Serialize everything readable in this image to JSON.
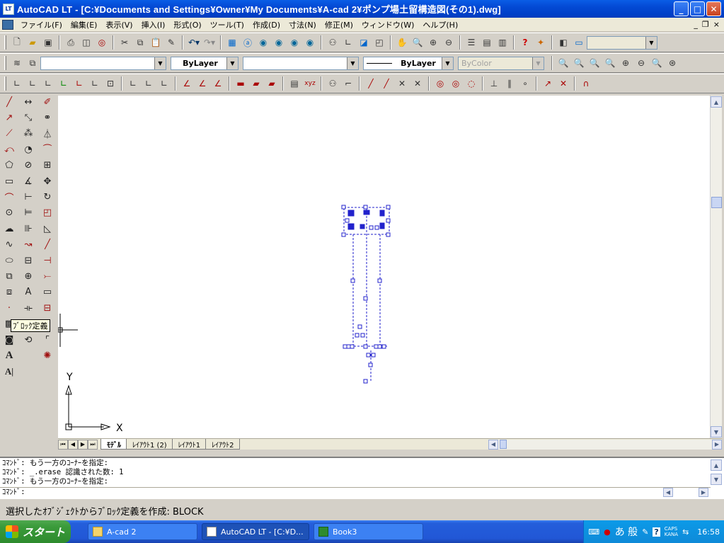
{
  "window": {
    "app_icon": "LT",
    "title": "AutoCAD LT - [C:¥Documents and Settings¥Owner¥My Documents¥A-cad 2¥ポンプ場土留構造図(その1).dwg]",
    "controls": [
      "minimize",
      "maximize",
      "close"
    ]
  },
  "menu": {
    "items": [
      "ファイル(F)",
      "編集(E)",
      "表示(V)",
      "挿入(I)",
      "形式(O)",
      "ツール(T)",
      "作成(D)",
      "寸法(N)",
      "修正(M)",
      "ウィンドウ(W)",
      "ヘルプ(H)"
    ],
    "mdi_controls": [
      "_",
      "❐",
      "×"
    ]
  },
  "toolbars": {
    "layer_dropdown": "",
    "color_dropdown": "ByLayer",
    "linetype_dropdown": "",
    "lineweight_dropdown": "ByLayer",
    "plotstyle_dropdown": "ByColor",
    "named_view_dropdown": ""
  },
  "tooltip": "ﾌﾞﾛｯｸ定義",
  "ucs": {
    "x_label": "X",
    "y_label": "Y"
  },
  "layout_tabs": [
    "ﾓﾃﾞﾙ",
    "ﾚｲｱｳﾄ1 (2)",
    "ﾚｲｱｳﾄ1",
    "ﾚｲｱｳﾄ2"
  ],
  "command_history": [
    "ｺﾏﾝﾄﾞ: もう一方のｺｰﾅｰを指定:",
    "ｺﾏﾝﾄﾞ: _.erase 認識された数: 1",
    "ｺﾏﾝﾄﾞ: もう一方のｺｰﾅｰを指定:"
  ],
  "command_prompt": "ｺﾏﾝﾄﾞ:",
  "status_text": "選択したｵﾌﾞｼﾞｪｸﾄからﾌﾞﾛｯｸ定義を作成:  BLOCK",
  "taskbar": {
    "start_label": "スタート",
    "tasks": [
      {
        "label": "A-cad 2",
        "icon": "folder-icon"
      },
      {
        "label": "AutoCAD LT - [C:¥D...",
        "icon": "autocad-icon"
      },
      {
        "label": "Book3",
        "icon": "excel-icon"
      }
    ],
    "ime_text": "あ 般",
    "caps": "CAPS",
    "kana": "KANA",
    "clock": "16:58"
  },
  "colors": {
    "selection_blue": "#2222cc",
    "titlebar_blue": "#0a5de6",
    "taskbar_blue": "#245edb",
    "start_green": "#3a9a3a"
  }
}
